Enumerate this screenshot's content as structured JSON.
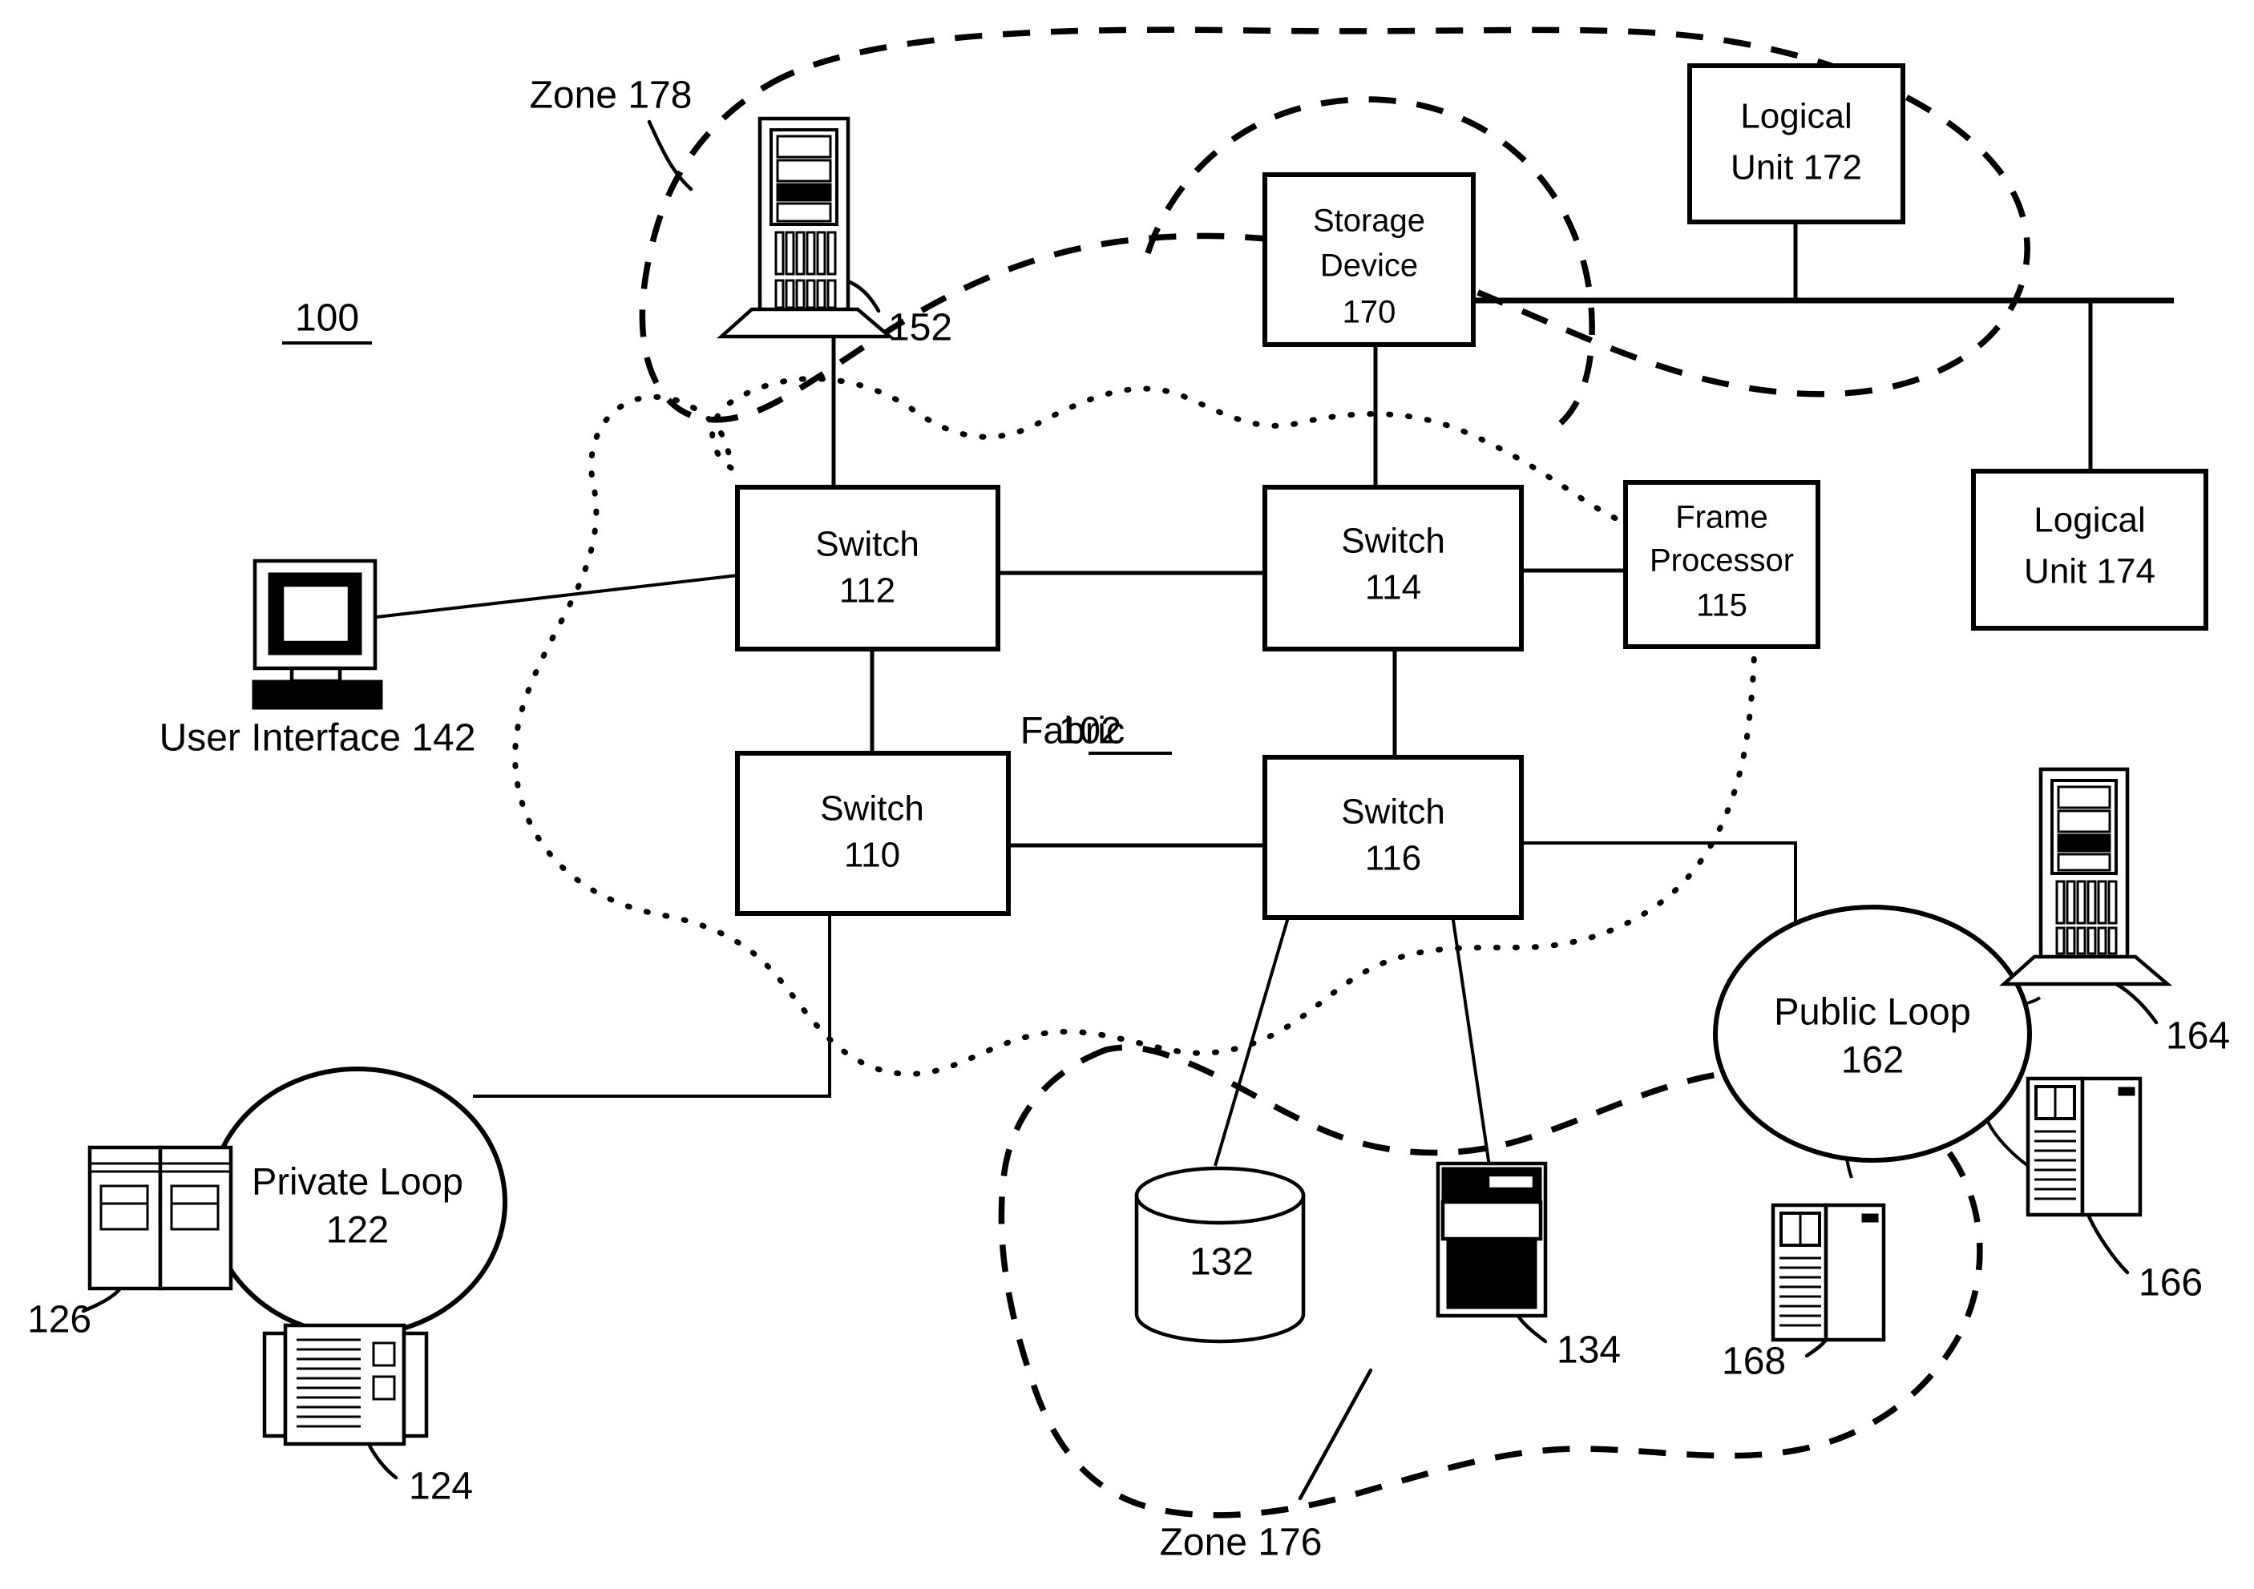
{
  "figure": {
    "number": "100",
    "underlined": true
  },
  "fabric": {
    "label_prefix": "Fabric",
    "label_number": "102",
    "underlined": true
  },
  "switches": [
    {
      "name": "Switch",
      "number": "112"
    },
    {
      "name": "Switch",
      "number": "114"
    },
    {
      "name": "Switch",
      "number": "110"
    },
    {
      "name": "Switch",
      "number": "116"
    }
  ],
  "boxes": {
    "frame_processor": {
      "line1": "Frame",
      "line2": "Processor",
      "line3": "115"
    },
    "storage_device": {
      "line1": "Storage",
      "line2": "Device",
      "line3": "170"
    },
    "logical_unit_172": {
      "line1": "Logical",
      "line2": "Unit 172"
    },
    "logical_unit_174": {
      "line1": "Logical",
      "line2": "Unit 174"
    }
  },
  "loops": [
    {
      "line1": "Private Loop",
      "line2": "122"
    },
    {
      "line1": "Public Loop",
      "line2": "162"
    }
  ],
  "zones": [
    {
      "label": "Zone 178"
    },
    {
      "label": "Zone 176"
    }
  ],
  "user_interface": {
    "label": "User Interface 142"
  },
  "reference_numerals": {
    "server_152": "152",
    "device_126": "126",
    "device_124": "124",
    "disk_132": "132",
    "tower_134": "134",
    "server_164": "164",
    "pc_166": "166",
    "pc_168": "168"
  },
  "colors": {
    "ink": "#000000",
    "paper": "#ffffff"
  }
}
